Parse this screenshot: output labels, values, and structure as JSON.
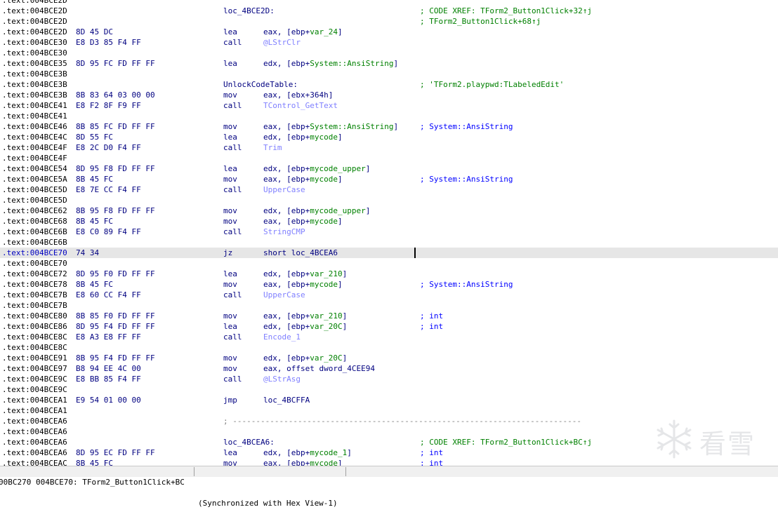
{
  "lines": [
    {
      "addr": ".text:004BCE2D",
      "bytes": "",
      "label": ""
    },
    {
      "addr": ".text:004BCE2D",
      "bytes": "",
      "label": "loc_4BCE2D:",
      "comment": "; CODE XREF: TForm2_Button1Click+32↑j",
      "comment_color": "green"
    },
    {
      "addr": ".text:004BCE2D",
      "bytes": "",
      "label": "",
      "comment": "; TForm2_Button1Click+68↑j",
      "comment_color": "green"
    },
    {
      "addr": ".text:004BCE2D",
      "bytes": "8D 45 DC",
      "mnemonic": "lea",
      "ops": [
        {
          "t": "eax, [ebp+"
        },
        {
          "t": "var_24",
          "k": "var"
        },
        {
          "t": "]"
        }
      ]
    },
    {
      "addr": ".text:004BCE30",
      "bytes": "E8 D3 85 F4 FF",
      "mnemonic": "call",
      "ops": [
        {
          "t": "@LStrClr",
          "k": "fn"
        }
      ]
    },
    {
      "addr": ".text:004BCE30",
      "bytes": ""
    },
    {
      "addr": ".text:004BCE35",
      "bytes": "8D 95 FC FD FF FF",
      "mnemonic": "lea",
      "ops": [
        {
          "t": "edx, [ebp+"
        },
        {
          "t": "System::AnsiString",
          "k": "var"
        },
        {
          "t": "]"
        }
      ]
    },
    {
      "addr": ".text:004BCE3B",
      "bytes": ""
    },
    {
      "addr": ".text:004BCE3B",
      "bytes": "",
      "label": "UnlockCodeTable:",
      "comment": "; 'TForm2.playpwd:TLabeledEdit'",
      "comment_color": "green"
    },
    {
      "addr": ".text:004BCE3B",
      "bytes": "8B 83 64 03 00 00",
      "mnemonic": "mov",
      "ops": [
        {
          "t": "eax, [ebx+364h]"
        }
      ]
    },
    {
      "addr": ".text:004BCE41",
      "bytes": "E8 F2 8F F9 FF",
      "mnemonic": "call",
      "ops": [
        {
          "t": "TControl_GetText",
          "k": "fn"
        }
      ]
    },
    {
      "addr": ".text:004BCE41",
      "bytes": ""
    },
    {
      "addr": ".text:004BCE46",
      "bytes": "8B 85 FC FD FF FF",
      "mnemonic": "mov",
      "ops": [
        {
          "t": "eax, [ebp+"
        },
        {
          "t": "System::AnsiString",
          "k": "var"
        },
        {
          "t": "]"
        }
      ],
      "comment": "; System::AnsiString",
      "comment_color": "blue"
    },
    {
      "addr": ".text:004BCE4C",
      "bytes": "8D 55 FC",
      "mnemonic": "lea",
      "ops": [
        {
          "t": "edx, [ebp+"
        },
        {
          "t": "mycode",
          "k": "var"
        },
        {
          "t": "]"
        }
      ]
    },
    {
      "addr": ".text:004BCE4F",
      "bytes": "E8 2C D0 F4 FF",
      "mnemonic": "call",
      "ops": [
        {
          "t": "Trim",
          "k": "fn"
        }
      ]
    },
    {
      "addr": ".text:004BCE4F",
      "bytes": ""
    },
    {
      "addr": ".text:004BCE54",
      "bytes": "8D 95 F8 FD FF FF",
      "mnemonic": "lea",
      "ops": [
        {
          "t": "edx, [ebp+"
        },
        {
          "t": "mycode_upper",
          "k": "var"
        },
        {
          "t": "]"
        }
      ]
    },
    {
      "addr": ".text:004BCE5A",
      "bytes": "8B 45 FC",
      "mnemonic": "mov",
      "ops": [
        {
          "t": "eax, [ebp+"
        },
        {
          "t": "mycode",
          "k": "var"
        },
        {
          "t": "]"
        }
      ],
      "comment": "; System::AnsiString",
      "comment_color": "blue"
    },
    {
      "addr": ".text:004BCE5D",
      "bytes": "E8 7E CC F4 FF",
      "mnemonic": "call",
      "ops": [
        {
          "t": "UpperCase",
          "k": "fn"
        }
      ]
    },
    {
      "addr": ".text:004BCE5D",
      "bytes": ""
    },
    {
      "addr": ".text:004BCE62",
      "bytes": "8B 95 F8 FD FF FF",
      "mnemonic": "mov",
      "ops": [
        {
          "t": "edx, [ebp+"
        },
        {
          "t": "mycode_upper",
          "k": "var"
        },
        {
          "t": "]"
        }
      ]
    },
    {
      "addr": ".text:004BCE68",
      "bytes": "8B 45 FC",
      "mnemonic": "mov",
      "ops": [
        {
          "t": "eax, [ebp+"
        },
        {
          "t": "mycode",
          "k": "var"
        },
        {
          "t": "]"
        }
      ]
    },
    {
      "addr": ".text:004BCE6B",
      "bytes": "E8 C0 89 F4 FF",
      "mnemonic": "call",
      "ops": [
        {
          "t": "StringCMP",
          "k": "fn"
        }
      ]
    },
    {
      "addr": ".text:004BCE6B",
      "bytes": ""
    },
    {
      "addr": ".text:004BCE70",
      "bytes": "74 34",
      "mnemonic": "jz",
      "ops": [
        {
          "t": "short loc_4BCEA6"
        }
      ],
      "selected": true
    },
    {
      "addr": ".text:004BCE70",
      "bytes": ""
    },
    {
      "addr": ".text:004BCE72",
      "bytes": "8D 95 F0 FD FF FF",
      "mnemonic": "lea",
      "ops": [
        {
          "t": "edx, [ebp+"
        },
        {
          "t": "var_210",
          "k": "var"
        },
        {
          "t": "]"
        }
      ]
    },
    {
      "addr": ".text:004BCE78",
      "bytes": "8B 45 FC",
      "mnemonic": "mov",
      "ops": [
        {
          "t": "eax, [ebp+"
        },
        {
          "t": "mycode",
          "k": "var"
        },
        {
          "t": "]"
        }
      ],
      "comment": "; System::AnsiString",
      "comment_color": "blue"
    },
    {
      "addr": ".text:004BCE7B",
      "bytes": "E8 60 CC F4 FF",
      "mnemonic": "call",
      "ops": [
        {
          "t": "UpperCase",
          "k": "fn"
        }
      ]
    },
    {
      "addr": ".text:004BCE7B",
      "bytes": ""
    },
    {
      "addr": ".text:004BCE80",
      "bytes": "8B 85 F0 FD FF FF",
      "mnemonic": "mov",
      "ops": [
        {
          "t": "eax, [ebp+"
        },
        {
          "t": "var_210",
          "k": "var"
        },
        {
          "t": "]"
        }
      ],
      "comment": "; int",
      "comment_color": "blue"
    },
    {
      "addr": ".text:004BCE86",
      "bytes": "8D 95 F4 FD FF FF",
      "mnemonic": "lea",
      "ops": [
        {
          "t": "edx, [ebp+"
        },
        {
          "t": "var_20C",
          "k": "var"
        },
        {
          "t": "]"
        }
      ],
      "comment": "; int",
      "comment_color": "blue"
    },
    {
      "addr": ".text:004BCE8C",
      "bytes": "E8 A3 E8 FF FF",
      "mnemonic": "call",
      "ops": [
        {
          "t": "Encode_1",
          "k": "fn"
        }
      ]
    },
    {
      "addr": ".text:004BCE8C",
      "bytes": ""
    },
    {
      "addr": ".text:004BCE91",
      "bytes": "8B 95 F4 FD FF FF",
      "mnemonic": "mov",
      "ops": [
        {
          "t": "edx, [ebp+"
        },
        {
          "t": "var_20C",
          "k": "var"
        },
        {
          "t": "]"
        }
      ]
    },
    {
      "addr": ".text:004BCE97",
      "bytes": "B8 94 EE 4C 00",
      "mnemonic": "mov",
      "ops": [
        {
          "t": "eax, offset dword_4CEE94"
        }
      ]
    },
    {
      "addr": ".text:004BCE9C",
      "bytes": "E8 BB 85 F4 FF",
      "mnemonic": "call",
      "ops": [
        {
          "t": "@LStrAsg",
          "k": "fn"
        }
      ]
    },
    {
      "addr": ".text:004BCE9C",
      "bytes": ""
    },
    {
      "addr": ".text:004BCEA1",
      "bytes": "E9 54 01 00 00",
      "mnemonic": "jmp",
      "ops": [
        {
          "t": "loc_4BCFFA"
        }
      ]
    },
    {
      "addr": ".text:004BCEA1",
      "bytes": ""
    },
    {
      "addr": ".text:004BCEA6",
      "bytes": "",
      "separator": "; ---------------------------------------------------------------------------"
    },
    {
      "addr": ".text:004BCEA6",
      "bytes": ""
    },
    {
      "addr": ".text:004BCEA6",
      "bytes": "",
      "label": "loc_4BCEA6:",
      "comment": "; CODE XREF: TForm2_Button1Click+BC↑j",
      "comment_color": "green"
    },
    {
      "addr": ".text:004BCEA6",
      "bytes": "8D 95 EC FD FF FF",
      "mnemonic": "lea",
      "ops": [
        {
          "t": "edx, [ebp+"
        },
        {
          "t": "mycode_1",
          "k": "var"
        },
        {
          "t": "]"
        }
      ],
      "comment": "; int",
      "comment_color": "blue"
    },
    {
      "addr": ".text:004BCEAC",
      "bytes": "8B 45 FC",
      "mnemonic": "mov",
      "ops": [
        {
          "t": "eax, [ebp+"
        },
        {
          "t": "mycode",
          "k": "var"
        },
        {
          "t": "]"
        }
      ],
      "comment": "; int",
      "comment_color": "blue"
    }
  ],
  "status": {
    "segment1": "00BC270 004BCE70: TForm2_Button1Click+BC",
    "segment2": "(Synchronized with Hex View-1)"
  },
  "watermark": {
    "text": "看雪",
    "icon": "snowflake-icon"
  }
}
